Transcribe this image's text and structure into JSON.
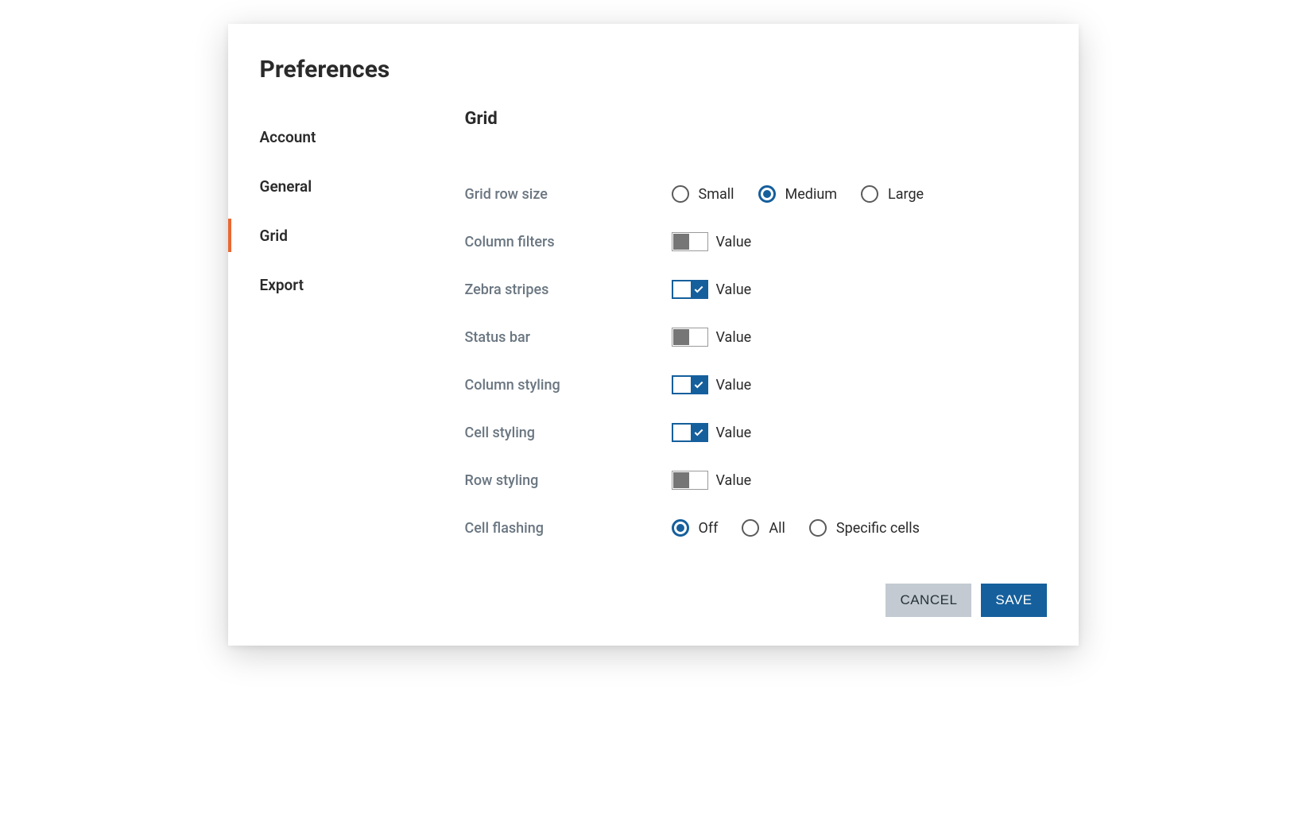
{
  "title": "Preferences",
  "sidebar": {
    "items": [
      {
        "label": "Account",
        "active": false
      },
      {
        "label": "General",
        "active": false
      },
      {
        "label": "Grid",
        "active": true
      },
      {
        "label": "Export",
        "active": false
      }
    ]
  },
  "panel": {
    "title": "Grid",
    "grid_row_size": {
      "label": "Grid row size",
      "options": [
        {
          "label": "Small",
          "selected": false
        },
        {
          "label": "Medium",
          "selected": true
        },
        {
          "label": "Large",
          "selected": false
        }
      ]
    },
    "column_filters": {
      "label": "Column filters",
      "value_label": "Value",
      "on": false
    },
    "zebra_stripes": {
      "label": "Zebra stripes",
      "value_label": "Value",
      "on": true
    },
    "status_bar": {
      "label": "Status bar",
      "value_label": "Value",
      "on": false
    },
    "column_styling": {
      "label": "Column styling",
      "value_label": "Value",
      "on": true
    },
    "cell_styling": {
      "label": "Cell styling",
      "value_label": "Value",
      "on": true
    },
    "row_styling": {
      "label": "Row styling",
      "value_label": "Value",
      "on": false
    },
    "cell_flashing": {
      "label": "Cell flashing",
      "options": [
        {
          "label": "Off",
          "selected": true
        },
        {
          "label": "All",
          "selected": false
        },
        {
          "label": "Specific cells",
          "selected": false
        }
      ]
    }
  },
  "footer": {
    "cancel_label": "CANCEL",
    "save_label": "SAVE"
  }
}
